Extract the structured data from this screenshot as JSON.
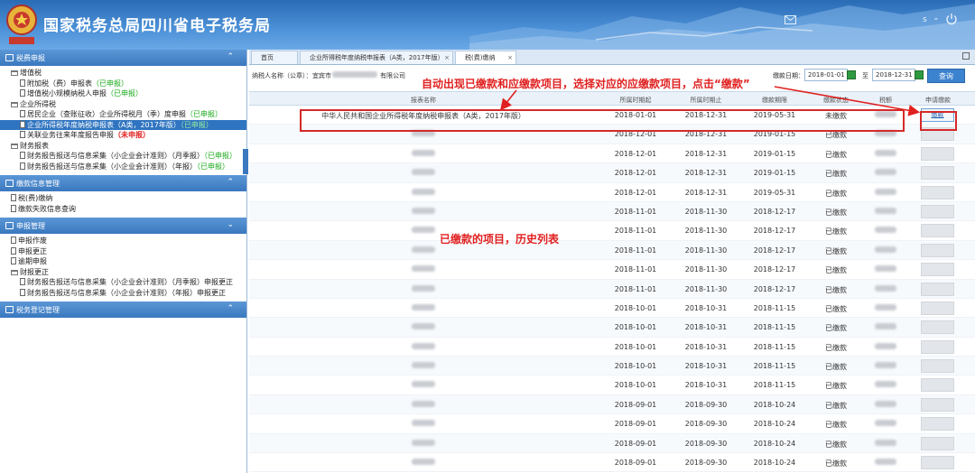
{
  "header": {
    "title": "国家税务总局四川省电子税务局",
    "user_initial": "s"
  },
  "sidebar": {
    "sections": [
      {
        "label": "税费申报",
        "items": [
          {
            "type": "folder",
            "label": "增值税",
            "status": "",
            "status_kind": ""
          },
          {
            "type": "doc",
            "label": "附加税（费）申报表",
            "status": "（已申报）",
            "status_kind": "green"
          },
          {
            "type": "doc",
            "label": "增值税小规模纳税人申报",
            "status": "（已申报）",
            "status_kind": "green"
          },
          {
            "type": "folder",
            "label": "企业所得税",
            "status": "",
            "status_kind": ""
          },
          {
            "type": "doc",
            "label": "居民企业（查账征收）企业所得税月（季）度申报",
            "status": "（已申报）",
            "status_kind": "green"
          },
          {
            "type": "doc",
            "label": "企业所得税年度纳税申报表（A类，2017年版）",
            "status": "（已申报）",
            "status_kind": "green",
            "selected": true
          },
          {
            "type": "doc",
            "label": "关联业务往来年度报告申报",
            "status": "（未申报）",
            "status_kind": "red"
          },
          {
            "type": "folder",
            "label": "财务报表",
            "status": "",
            "status_kind": ""
          },
          {
            "type": "doc",
            "label": "财务报告报送与信息采集（小企业会计准则）（月季报）",
            "status": "（已申报）",
            "status_kind": "green"
          },
          {
            "type": "doc",
            "label": "财务报告报送与信息采集（小企业会计准则）（年报）",
            "status": "（已申报）",
            "status_kind": "green"
          }
        ]
      },
      {
        "label": "缴款信息管理",
        "items": [
          {
            "type": "doc",
            "label": "税(费)缴纳",
            "status": "",
            "status_kind": ""
          },
          {
            "type": "doc",
            "label": "缴款失败信息查询",
            "status": "",
            "status_kind": ""
          }
        ]
      },
      {
        "label": "申报管理",
        "items": [
          {
            "type": "doc",
            "label": "申报作废",
            "status": "",
            "status_kind": ""
          },
          {
            "type": "doc",
            "label": "申报更正",
            "status": "",
            "status_kind": ""
          },
          {
            "type": "doc",
            "label": "逾期申报",
            "status": "",
            "status_kind": ""
          },
          {
            "type": "folder",
            "label": "财报更正",
            "status": "",
            "status_kind": ""
          },
          {
            "type": "doc",
            "label": "财务报告报送与信息采集（小企业会计准则）（月季报）申报更正",
            "status": "",
            "status_kind": ""
          },
          {
            "type": "doc",
            "label": "财务报告报送与信息采集（小企业会计准则）（年报）申报更正",
            "status": "",
            "status_kind": ""
          }
        ]
      },
      {
        "label": "税务登记管理",
        "items": []
      }
    ]
  },
  "tabs": [
    {
      "label": "首页",
      "closable": false
    },
    {
      "label": "企业所得税年度纳税申报表（A类，2017年版）",
      "closable": true
    },
    {
      "label": "税(费)缴纳",
      "closable": true
    }
  ],
  "query": {
    "taxpayer_label": "纳税人名称（公章）：",
    "taxpayer_value_prefix": "宜宾市",
    "taxpayer_value_suffix": "有限公司",
    "date_label": "缴款日期：",
    "date_from": "2018-01-01",
    "date_sep": "至",
    "date_to": "2018-12-31",
    "query_button": "查询"
  },
  "grid": {
    "columns": [
      "报表名称",
      "所属时期起",
      "所属时期止",
      "缴款期限",
      "缴款状态",
      "税额",
      "申请缴款"
    ],
    "rows": [
      {
        "name": "中华人民共和国企业所得税年度纳税申报表（A类，2017年版）",
        "start": "2018-01-01",
        "end": "2018-12-31",
        "deadline": "2019-05-31",
        "status": "未缴款",
        "action": "缴款",
        "enabled": true
      },
      {
        "name": "",
        "start": "2018-12-01",
        "end": "2018-12-31",
        "deadline": "2019-01-15",
        "status": "已缴款",
        "action": "",
        "enabled": false
      },
      {
        "name": "",
        "start": "2018-12-01",
        "end": "2018-12-31",
        "deadline": "2019-01-15",
        "status": "已缴款",
        "action": "",
        "enabled": false
      },
      {
        "name": "",
        "start": "2018-12-01",
        "end": "2018-12-31",
        "deadline": "2019-01-15",
        "status": "已缴款",
        "action": "",
        "enabled": false
      },
      {
        "name": "",
        "start": "2018-12-01",
        "end": "2018-12-31",
        "deadline": "2019-05-31",
        "status": "已缴款",
        "action": "",
        "enabled": false
      },
      {
        "name": "",
        "start": "2018-11-01",
        "end": "2018-11-30",
        "deadline": "2018-12-17",
        "status": "已缴款",
        "action": "",
        "enabled": false
      },
      {
        "name": "",
        "start": "2018-11-01",
        "end": "2018-11-30",
        "deadline": "2018-12-17",
        "status": "已缴款",
        "action": "",
        "enabled": false
      },
      {
        "name": "",
        "start": "2018-11-01",
        "end": "2018-11-30",
        "deadline": "2018-12-17",
        "status": "已缴款",
        "action": "",
        "enabled": false
      },
      {
        "name": "",
        "start": "2018-11-01",
        "end": "2018-11-30",
        "deadline": "2018-12-17",
        "status": "已缴款",
        "action": "",
        "enabled": false
      },
      {
        "name": "",
        "start": "2018-11-01",
        "end": "2018-11-30",
        "deadline": "2018-12-17",
        "status": "已缴款",
        "action": "",
        "enabled": false
      },
      {
        "name": "",
        "start": "2018-10-01",
        "end": "2018-10-31",
        "deadline": "2018-11-15",
        "status": "已缴款",
        "action": "",
        "enabled": false
      },
      {
        "name": "",
        "start": "2018-10-01",
        "end": "2018-10-31",
        "deadline": "2018-11-15",
        "status": "已缴款",
        "action": "",
        "enabled": false
      },
      {
        "name": "",
        "start": "2018-10-01",
        "end": "2018-10-31",
        "deadline": "2018-11-15",
        "status": "已缴款",
        "action": "",
        "enabled": false
      },
      {
        "name": "",
        "start": "2018-10-01",
        "end": "2018-10-31",
        "deadline": "2018-11-15",
        "status": "已缴款",
        "action": "",
        "enabled": false
      },
      {
        "name": "",
        "start": "2018-10-01",
        "end": "2018-10-31",
        "deadline": "2018-11-15",
        "status": "已缴款",
        "action": "",
        "enabled": false
      },
      {
        "name": "",
        "start": "2018-09-01",
        "end": "2018-09-30",
        "deadline": "2018-10-24",
        "status": "已缴款",
        "action": "",
        "enabled": false
      },
      {
        "name": "",
        "start": "2018-09-01",
        "end": "2018-09-30",
        "deadline": "2018-10-24",
        "status": "已缴款",
        "action": "",
        "enabled": false
      },
      {
        "name": "",
        "start": "2018-09-01",
        "end": "2018-09-30",
        "deadline": "2018-10-24",
        "status": "已缴款",
        "action": "",
        "enabled": false
      },
      {
        "name": "",
        "start": "2018-09-01",
        "end": "2018-09-30",
        "deadline": "2018-10-24",
        "status": "已缴款",
        "action": "",
        "enabled": false
      }
    ]
  },
  "annotations": {
    "top": "自动出现已缴款和应缴款项目，选择对应的应缴款项目，点击“缴款”",
    "middle": "已缴款的项目，历史列表",
    "color": "#e02020"
  }
}
